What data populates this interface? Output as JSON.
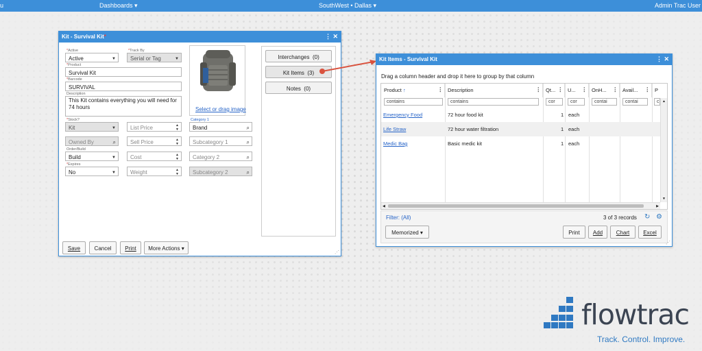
{
  "topbar": {
    "menu_label": "u",
    "dashboards_label": "Dashboards ▾",
    "location_label": "SouthWest • Dallas ▾",
    "user_label": "Admin Trac User"
  },
  "kit_window": {
    "title": "Kit - Survival Kit",
    "fields": {
      "active": {
        "label": "Active",
        "value": "Active"
      },
      "track_by": {
        "label": "Track By",
        "value": "Serial or Tag"
      },
      "product": {
        "label": "Product",
        "value": "Survival Kit"
      },
      "barcode": {
        "label": "Barcode",
        "value": "SURVIVAL"
      },
      "description": {
        "label": "Description",
        "value": "This Kit contains everything you will need for 74 hours"
      },
      "stock": {
        "label": "Stock?",
        "value": "Kit"
      },
      "owned_by": {
        "placeholder": "Owned By"
      },
      "order_build": {
        "label": "Order/Build",
        "value": "Build"
      },
      "expires": {
        "label": "Expires",
        "value": "No"
      },
      "list_price": {
        "placeholder": "List Price"
      },
      "sell_price": {
        "placeholder": "Sell Price"
      },
      "cost": {
        "placeholder": "Cost"
      },
      "weight": {
        "placeholder": "Weight"
      },
      "category1": {
        "label": "Category 1",
        "value": "Brand"
      },
      "subcategory1": {
        "placeholder": "Subcategory 1"
      },
      "category2": {
        "placeholder": "Category 2"
      },
      "subcategory2": {
        "placeholder": "Subcategory 2"
      }
    },
    "image_link": "Select or drag image",
    "side_tabs": [
      {
        "label": "Interchanges",
        "count": "(0)"
      },
      {
        "label": "Kit Items",
        "count": "(3)"
      },
      {
        "label": "Notes",
        "count": "(0)"
      }
    ],
    "buttons": {
      "save": "Save",
      "cancel": "Cancel",
      "print": "Print",
      "more_actions": "More Actions ▾"
    }
  },
  "items_window": {
    "title": "Kit Items - Survival Kit",
    "group_hint": "Drag a column header and drop it here to group by that column",
    "columns": [
      "Product",
      "Description",
      "Qt...",
      "U...",
      "OnH...",
      "Avail...",
      "P"
    ],
    "filters": [
      "contains",
      "contains",
      "cor",
      "cor",
      "contai",
      "contai",
      "c"
    ],
    "rows": [
      {
        "product": "Emergency Food",
        "description": "72 hour food kit",
        "qty": "1",
        "unit": "each"
      },
      {
        "product": "Life Straw",
        "description": "72 hour water filtration",
        "qty": "1",
        "unit": "each"
      },
      {
        "product": "Medic Bag",
        "description": "Basic medic kit",
        "qty": "1",
        "unit": "each"
      }
    ],
    "filter_status": "Filter: (All)",
    "record_count": "3 of 3 records",
    "memorized": "Memorized ▾",
    "buttons": {
      "print": "Print",
      "add": "Add",
      "chart": "Chart",
      "excel": "Excel"
    }
  },
  "brand": {
    "name": "flowtrac",
    "tagline": "Track. Control. Improve.",
    "blue": "#2f79c2",
    "dark": "#3b4452"
  }
}
